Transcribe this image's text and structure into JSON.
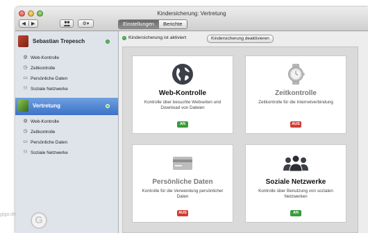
{
  "window": {
    "title": "Kindersicherung: Vertretung"
  },
  "toolbar": {
    "back_label": "◀",
    "forward_label": "▶",
    "users_icon": "users-icon",
    "gear_label": "⚙▾"
  },
  "tabs": [
    {
      "label": "Einstellungen",
      "active": true
    },
    {
      "label": "Berichte",
      "active": false
    }
  ],
  "sidebar": {
    "users": [
      {
        "name": "Sebastian Trepesch",
        "selected": false,
        "items": [
          "Web-Kontrolle",
          "Zeitkontrolle",
          "Persönliche Daten",
          "Soziale Netzwerke"
        ]
      },
      {
        "name": "Vertretung",
        "selected": true,
        "items": [
          "Web-Kontrolle",
          "Zeitkontrolle",
          "Persönliche Daten",
          "Soziale Netzwerke"
        ]
      }
    ]
  },
  "status": {
    "text": "Kindersicherung ist aktiviert",
    "button_label": "Kindersicherung deaktivieren"
  },
  "cards": [
    {
      "title": "Web-Kontrolle",
      "desc": "Kontrolle über besuchte Webseiten und Download von Dateien",
      "badge": "AN",
      "state": "on",
      "icon": "globe-icon"
    },
    {
      "title": "Zeitkontrolle",
      "desc": "Zeitkontrolle für die Internetverbindung",
      "badge": "AUS",
      "state": "off",
      "icon": "watch-icon"
    },
    {
      "title": "Persönliche Daten",
      "desc": "Kontrolle für die Verwendung persönlicher Daten",
      "badge": "AUS",
      "state": "off",
      "icon": "credit-card-icon"
    },
    {
      "title": "Soziale Netzwerke",
      "desc": "Kontrolle über Benutzung von sozialen Netzwerken",
      "badge": "AN",
      "state": "on",
      "icon": "people-icon"
    }
  ],
  "watermark": {
    "text": "giga.de",
    "logo_letter": "G"
  },
  "colors": {
    "selected_row": "#3c72c8",
    "badge_on": "#3b9a3b",
    "badge_off": "#d23b33"
  }
}
